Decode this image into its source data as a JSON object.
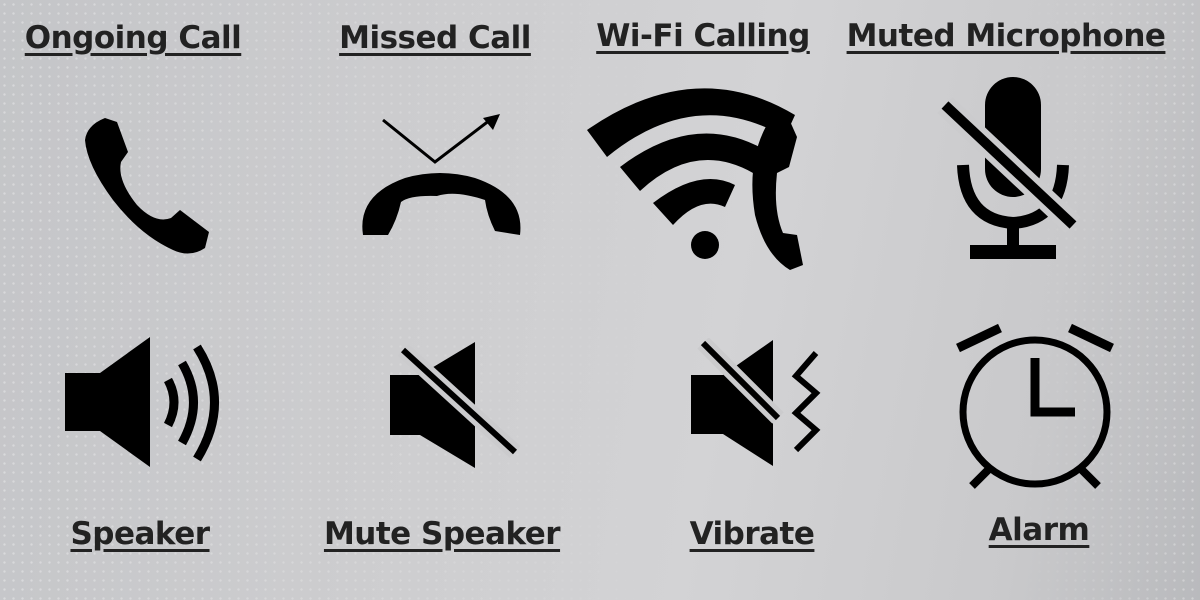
{
  "icons": [
    {
      "label": "Ongoing Call",
      "icon": "phone-icon"
    },
    {
      "label": "Missed Call",
      "icon": "missed-call-icon"
    },
    {
      "label": "Wi-Fi Calling",
      "icon": "wifi-calling-icon"
    },
    {
      "label": "Muted Microphone",
      "icon": "muted-microphone-icon"
    },
    {
      "label": "Speaker",
      "icon": "speaker-icon"
    },
    {
      "label": "Mute Speaker",
      "icon": "mute-speaker-icon"
    },
    {
      "label": "Vibrate",
      "icon": "vibrate-icon"
    },
    {
      "label": "Alarm",
      "icon": "alarm-icon"
    }
  ],
  "colors": {
    "icon": "#000000",
    "text": "#222222",
    "background": "#cbcbcd"
  }
}
